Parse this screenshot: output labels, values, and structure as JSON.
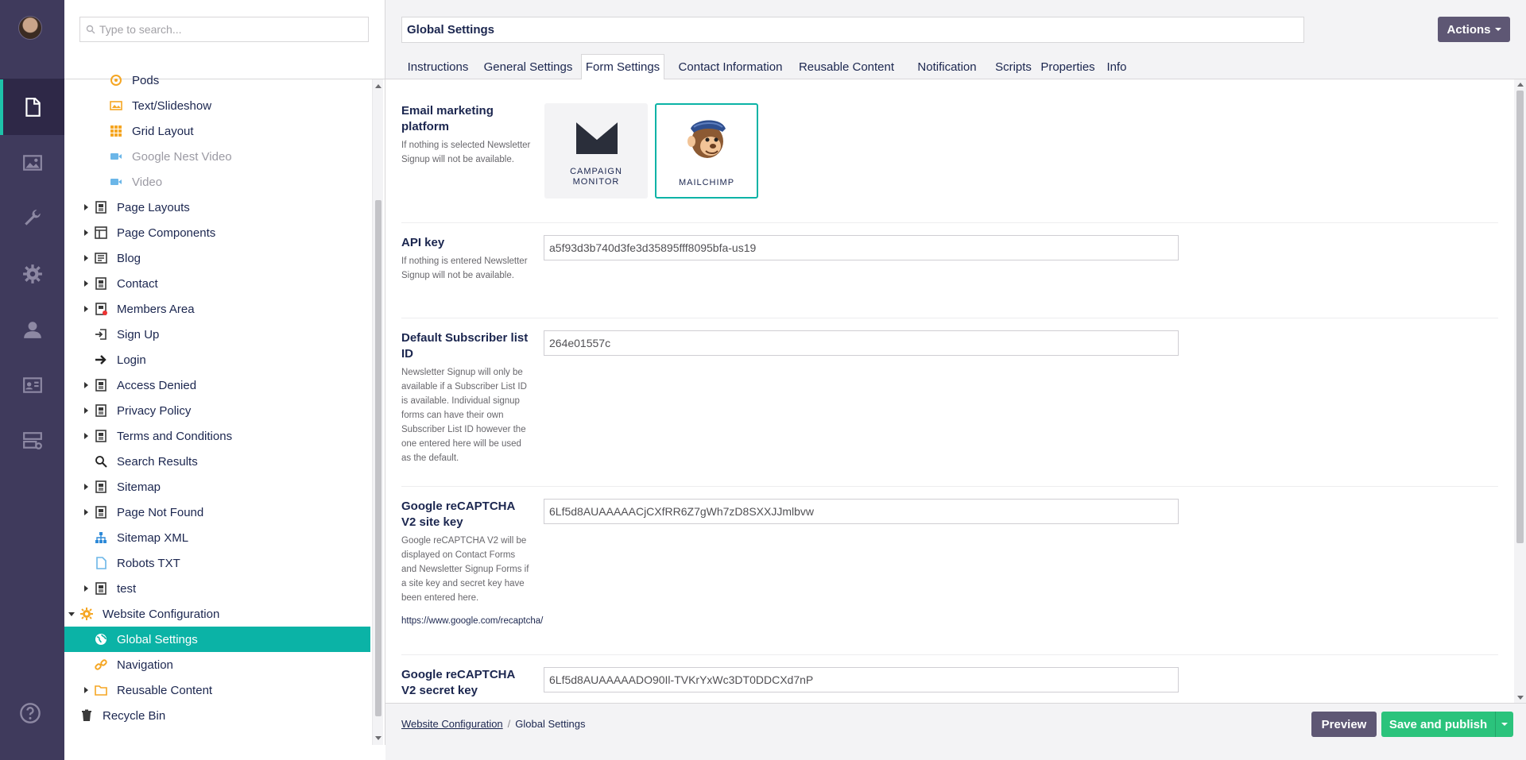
{
  "rail": {
    "items": [
      {
        "icon": "content-icon",
        "active": true
      },
      {
        "icon": "media-icon"
      },
      {
        "icon": "wrench-icon"
      },
      {
        "icon": "gear-icon"
      },
      {
        "icon": "user-icon"
      },
      {
        "icon": "contact-card-icon"
      },
      {
        "icon": "forms-icon"
      }
    ],
    "help_icon": "help-icon"
  },
  "tree": {
    "search_placeholder": "Type to search...",
    "items": [
      {
        "label": "Pods",
        "icon": "pods-icon",
        "caret": false
      },
      {
        "label": "Text/Slideshow",
        "icon": "image-icon",
        "caret": false
      },
      {
        "label": "Grid Layout",
        "icon": "grid-icon",
        "caret": false
      },
      {
        "label": "Google Nest Video",
        "icon": "video-icon",
        "caret": false,
        "dim": true
      },
      {
        "label": "Video",
        "icon": "video-icon",
        "caret": false,
        "dim": true
      },
      {
        "label": "Page Layouts",
        "icon": "page-icon",
        "caret": true
      },
      {
        "label": "Page Components",
        "icon": "layout-icon",
        "caret": true
      },
      {
        "label": "Blog",
        "icon": "blog-icon",
        "caret": true
      },
      {
        "label": "Contact",
        "icon": "page-icon",
        "caret": true
      },
      {
        "label": "Members Area",
        "icon": "page-protected-icon",
        "caret": true
      },
      {
        "label": "Sign Up",
        "icon": "sign-in-icon",
        "caret": false
      },
      {
        "label": "Login",
        "icon": "arrow-right-icon",
        "caret": false
      },
      {
        "label": "Access Denied",
        "icon": "page-icon",
        "caret": true
      },
      {
        "label": "Privacy Policy",
        "icon": "page-icon",
        "caret": true
      },
      {
        "label": "Terms and Conditions",
        "icon": "page-icon",
        "caret": true
      },
      {
        "label": "Search Results",
        "icon": "search-icon",
        "caret": false
      },
      {
        "label": "Sitemap",
        "icon": "page-icon",
        "caret": true
      },
      {
        "label": "Page Not Found",
        "icon": "page-icon",
        "caret": true
      },
      {
        "label": "Sitemap XML",
        "icon": "sitemap-icon",
        "caret": false
      },
      {
        "label": "Robots TXT",
        "icon": "document-icon",
        "caret": false
      },
      {
        "label": "test",
        "icon": "page-icon",
        "caret": true
      },
      {
        "label": "Website Configuration",
        "icon": "settings-gear-icon",
        "caret": "open"
      },
      {
        "label": "Global Settings",
        "icon": "globe-icon",
        "caret": false,
        "selected": true
      },
      {
        "label": "Navigation",
        "icon": "link-icon",
        "caret": false
      },
      {
        "label": "Reusable Content",
        "icon": "folder-icon",
        "caret": true
      },
      {
        "label": "Recycle Bin",
        "icon": "trash-icon",
        "caret": false
      }
    ]
  },
  "editor": {
    "node_name": "Global Settings",
    "actions_label": "Actions",
    "tabs": [
      "Instructions",
      "General Settings",
      "Form Settings",
      "Contact Information",
      "Reusable Content",
      "Notification",
      "Scripts",
      "Properties",
      "Info"
    ],
    "active_tab": "Form Settings",
    "properties": {
      "email_platform": {
        "label": "Email marketing platform",
        "description": "If nothing is selected Newsletter Signup will not be available.",
        "options": [
          {
            "line1": "CAMPAIGN",
            "line2": "MONITOR",
            "icon": "campaign-monitor-logo-icon"
          },
          {
            "line1": "MAILCHIMP",
            "icon": "mailchimp-logo-icon",
            "selected": true
          }
        ]
      },
      "api_key": {
        "label": "API key",
        "description": "If nothing is entered Newsletter Signup will not be available.",
        "value": "a5f93d3b740d3fe3d35895fff8095bfa-us19"
      },
      "subscriber_list": {
        "label": "Default Subscriber list ID",
        "description": "Newsletter Signup will only be available if a Subscriber List ID is available. Individual signup forms can have their own Subscriber List ID however the one entered here will be used as the default.",
        "value": "264e01557c"
      },
      "recaptcha_site": {
        "label": "Google reCAPTCHA V2 site key",
        "description": "Google reCAPTCHA V2 will be displayed on Contact Forms and Newsletter Signup Forms if a site key and secret key have been entered here.",
        "link": "https://www.google.com/recaptcha/",
        "value": "6Lf5d8AUAAAAACjCXfRR6Z7gWh7zD8SXXJJmlbvw"
      },
      "recaptcha_secret": {
        "label": "Google reCAPTCHA V2 secret key",
        "value": "6Lf5d8AUAAAAADO90Il-TVKrYxWc3DT0DDCXd7nP"
      }
    }
  },
  "footer": {
    "breadcrumb": [
      "Website Configuration",
      "Global Settings"
    ],
    "preview_label": "Preview",
    "save_label": "Save and publish"
  },
  "colors": {
    "rail": "#3f3a5c",
    "accent": "#0bb3a6",
    "button": "#5e5774",
    "save": "#2bc37c",
    "text": "#1b264f"
  }
}
